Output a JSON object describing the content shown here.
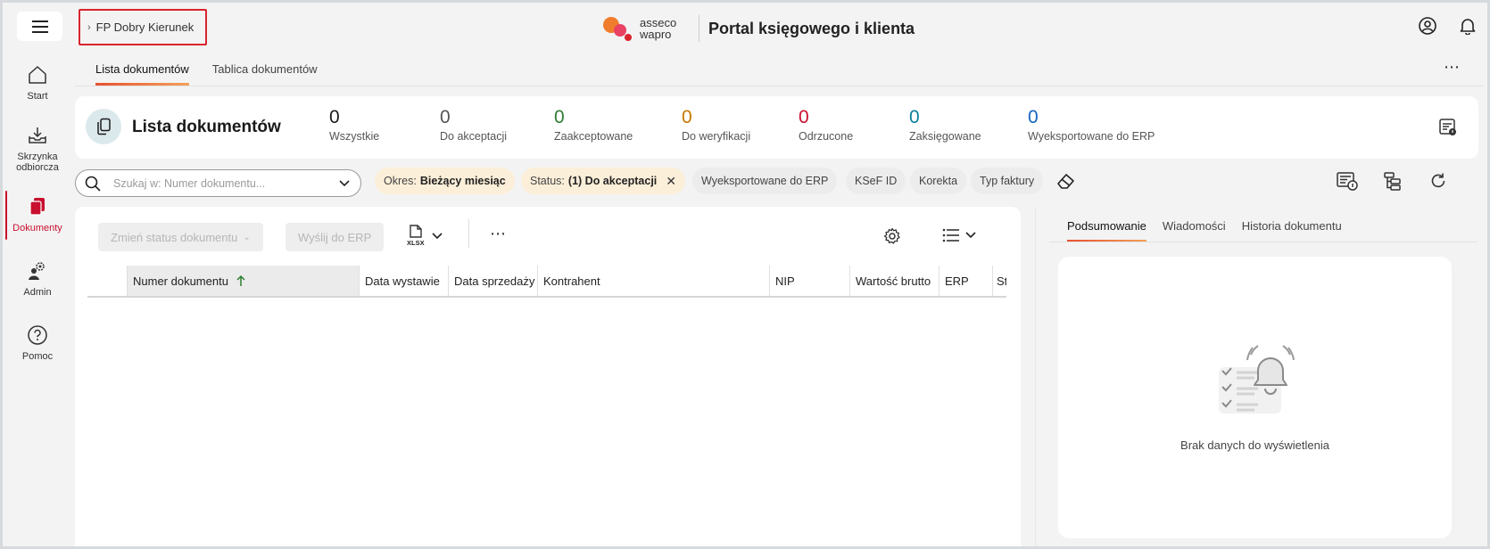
{
  "header": {
    "breadcrumb": "FP Dobry Kierunek",
    "brand_line1": "asseco",
    "brand_line2": "wapro",
    "portal_title": "Portal księgowego i klienta"
  },
  "sidebar": {
    "items": [
      {
        "label": "Start",
        "icon": "home-icon"
      },
      {
        "label": "Skrzynka odbiorcza",
        "icon": "inbox-icon"
      },
      {
        "label": "Dokumenty",
        "icon": "documents-icon"
      },
      {
        "label": "Admin",
        "icon": "admin-gear-icon"
      },
      {
        "label": "Pomoc",
        "icon": "help-icon"
      }
    ],
    "active": "Dokumenty"
  },
  "tabs": [
    {
      "label": "Lista dokumentów",
      "active": true
    },
    {
      "label": "Tablica dokumentów",
      "active": false
    }
  ],
  "summary": {
    "title": "Lista dokumentów",
    "stats": [
      {
        "value": "0",
        "label": "Wszystkie",
        "color": "#1a1a1a"
      },
      {
        "value": "0",
        "label": "Do akceptacji",
        "color": "#555555"
      },
      {
        "value": "0",
        "label": "Zaakceptowane",
        "color": "#2e7d32"
      },
      {
        "value": "0",
        "label": "Do weryfikacji",
        "color": "#c77700"
      },
      {
        "value": "0",
        "label": "Odrzucone",
        "color": "#c8102e"
      },
      {
        "value": "0",
        "label": "Zaksięgowane",
        "color": "#0a7f9e"
      },
      {
        "value": "0",
        "label": "Wyeksportowane do ERP",
        "color": "#1565c0"
      }
    ]
  },
  "search": {
    "placeholder": "Szukaj w: Numer dokumentu..."
  },
  "filters": {
    "period_label": "Okres:",
    "period_value": "Bieżący miesiąc",
    "status_label": "Status:",
    "status_value": "(1) Do akceptacji",
    "chips": [
      "Wyeksportowane do ERP",
      "KSeF ID",
      "Korekta",
      "Typ faktury"
    ]
  },
  "toolbar": {
    "change_status": "Zmień status dokumentu",
    "send_erp": "Wyślij do ERP",
    "xlsx": "XLSX"
  },
  "table": {
    "columns": [
      "Numer dokumentu",
      "Data wystawie",
      "Data sprzedaży",
      "Kontrahent",
      "NIP",
      "Wartość brutto",
      "ERP",
      "St"
    ],
    "sorted_column": "Numer dokumentu",
    "rows": []
  },
  "right_panel": {
    "tabs": [
      {
        "label": "Podsumowanie",
        "active": true
      },
      {
        "label": "Wiadomości",
        "active": false
      },
      {
        "label": "Historia dokumentu",
        "active": false
      }
    ],
    "empty_text": "Brak danych do wyświetlenia"
  }
}
